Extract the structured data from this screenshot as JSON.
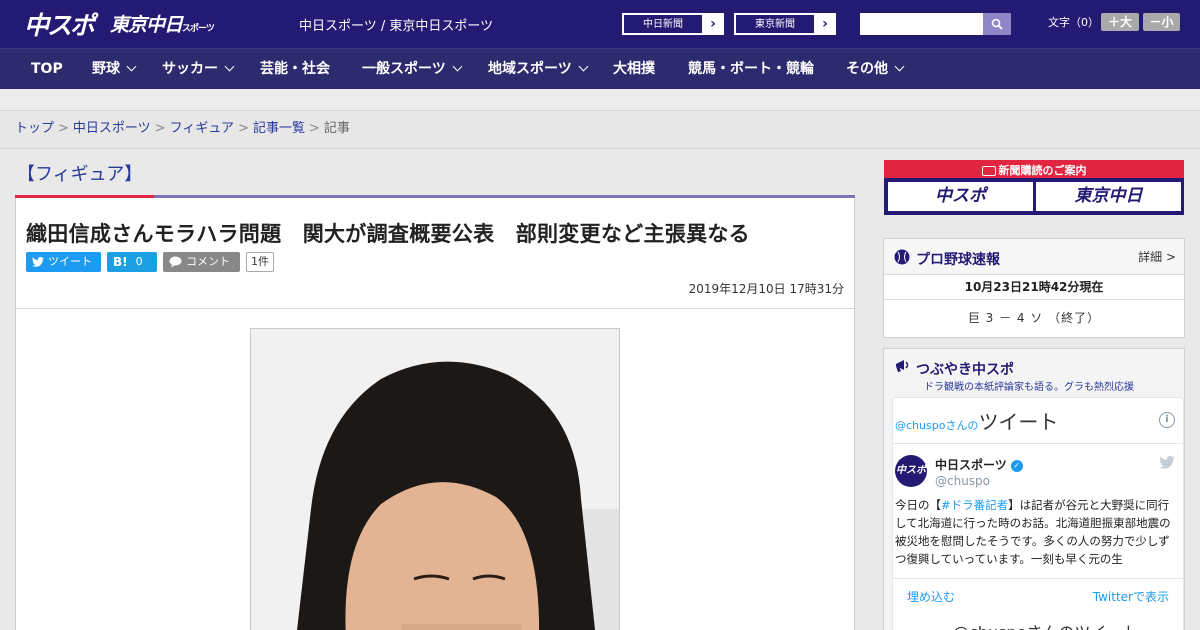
{
  "header": {
    "logo_chuspo": "中スポ",
    "logo_tokyo": "東京中日",
    "logo_tokyo_small": "スポーツ",
    "site_links": "中日スポーツ / 東京中日スポーツ",
    "paper_buttons": [
      "中日新聞",
      "東京新聞"
    ],
    "search_placeholder": "",
    "font_size_label": "文字（0）",
    "font_larger": "＋大",
    "font_smaller": "－小"
  },
  "nav": {
    "items": [
      {
        "label": "TOP",
        "dropdown": false
      },
      {
        "label": "野球",
        "dropdown": true
      },
      {
        "label": "サッカー",
        "dropdown": true
      },
      {
        "label": "芸能・社会",
        "dropdown": false
      },
      {
        "label": "一般スポーツ",
        "dropdown": true
      },
      {
        "label": "地域スポーツ",
        "dropdown": true
      },
      {
        "label": "大相撲",
        "dropdown": false
      },
      {
        "label": "競馬・ボート・競輪",
        "dropdown": false
      },
      {
        "label": "その他",
        "dropdown": true
      }
    ]
  },
  "breadcrumb": {
    "items": [
      "トップ",
      "中日スポーツ",
      "フィギュア",
      "記事一覧"
    ],
    "current": "記事"
  },
  "article": {
    "category": "【フィギュア】",
    "headline": "織田信成さんモラハラ問題　関大が調査概要公表　部則変更など主張異なる",
    "share": {
      "tweet": "ツイート",
      "hatena_label": "B!",
      "hatena_count": "0",
      "comment": "コメント",
      "comment_count": "1件"
    },
    "date": "2019年12月10日 17時31分"
  },
  "sidebar": {
    "ad_title": "新聞購読のご案内",
    "ad_logos": [
      "中スポ",
      "東京中日"
    ],
    "baseball": {
      "title": "プロ野球速報",
      "detail": "詳細 >",
      "time": "10月23日21時42分現在",
      "score": "巨 3 － 4 ソ （終了）"
    },
    "tweets": {
      "title": "つぶやき中スポ",
      "subtitle": "ドラ観戦の本紙評論家も語る。グラも熱烈応援",
      "embed_handle_label": "@chuspoさんの",
      "embed_title": "ツイート",
      "account_name": "中日スポーツ",
      "account_handle": "@chuspo",
      "avatar_text": "中スポ",
      "tweet_pre": "今日の【",
      "tweet_tag": "#ドラ番記者",
      "tweet_post": "】は記者が谷元と大野奨に同行して北海道に行った時のお話。北海道胆振東部地震の被災地を慰問したそうです。多くの人の努力で少しずつ復興していっています。一刻も早く元の生",
      "embed_link": "埋め込む",
      "view_link": "Twitterで表示",
      "footer_title": "@chuspoさんのツイート"
    }
  },
  "colors": {
    "brand": "#231a73",
    "nav": "#2e2a6e",
    "accent_red": "#e1243f",
    "twitter": "#1d9bf0"
  }
}
